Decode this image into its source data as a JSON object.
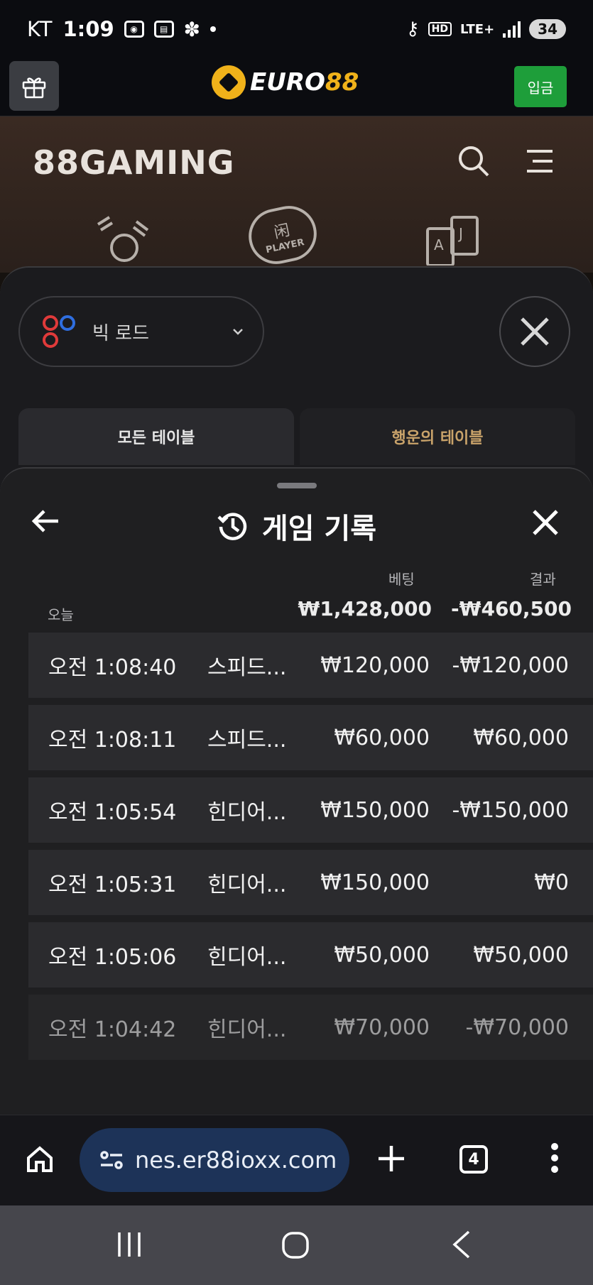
{
  "status_bar": {
    "carrier": "KT",
    "time": "1:09",
    "network": "LTE+",
    "hd": "HD",
    "battery": "34"
  },
  "site_header": {
    "brand_word": "EURO",
    "brand_number": "88",
    "deposit_label": "입금"
  },
  "gaming_header": {
    "logo_text": "88GAMING",
    "player_badge": "PLAYER",
    "player_char": "闲"
  },
  "road_panel": {
    "road_select_label": "빅 로드",
    "tabs": [
      {
        "label": "모든 테이블"
      },
      {
        "label": "행운의 테이블"
      }
    ]
  },
  "history": {
    "title": "게임 기록",
    "col_bet": "베팅",
    "col_result": "결과",
    "today_label": "오늘",
    "total_bet": "₩1,428,000",
    "total_result": "-₩460,500",
    "rows": [
      {
        "time": "오전 1:08:40",
        "game": "스피드...",
        "bet": "₩120,000",
        "result": "-₩120,000"
      },
      {
        "time": "오전 1:08:11",
        "game": "스피드...",
        "bet": "₩60,000",
        "result": "₩60,000"
      },
      {
        "time": "오전 1:05:54",
        "game": "힌디어...",
        "bet": "₩150,000",
        "result": "-₩150,000"
      },
      {
        "time": "오전 1:05:31",
        "game": "힌디어...",
        "bet": "₩150,000",
        "result": "₩0"
      },
      {
        "time": "오전 1:05:06",
        "game": "힌디어...",
        "bet": "₩50,000",
        "result": "₩50,000"
      },
      {
        "time": "오전 1:04:42",
        "game": "힌디어...",
        "bet": "₩70,000",
        "result": "-₩70,000"
      }
    ]
  },
  "browser": {
    "url": "nes.er88ioxx.com",
    "tab_count": "4"
  },
  "colors": {
    "accent_gold": "#f0b21a",
    "deposit_green": "#1e9e3a",
    "url_pill": "#1d3358"
  }
}
